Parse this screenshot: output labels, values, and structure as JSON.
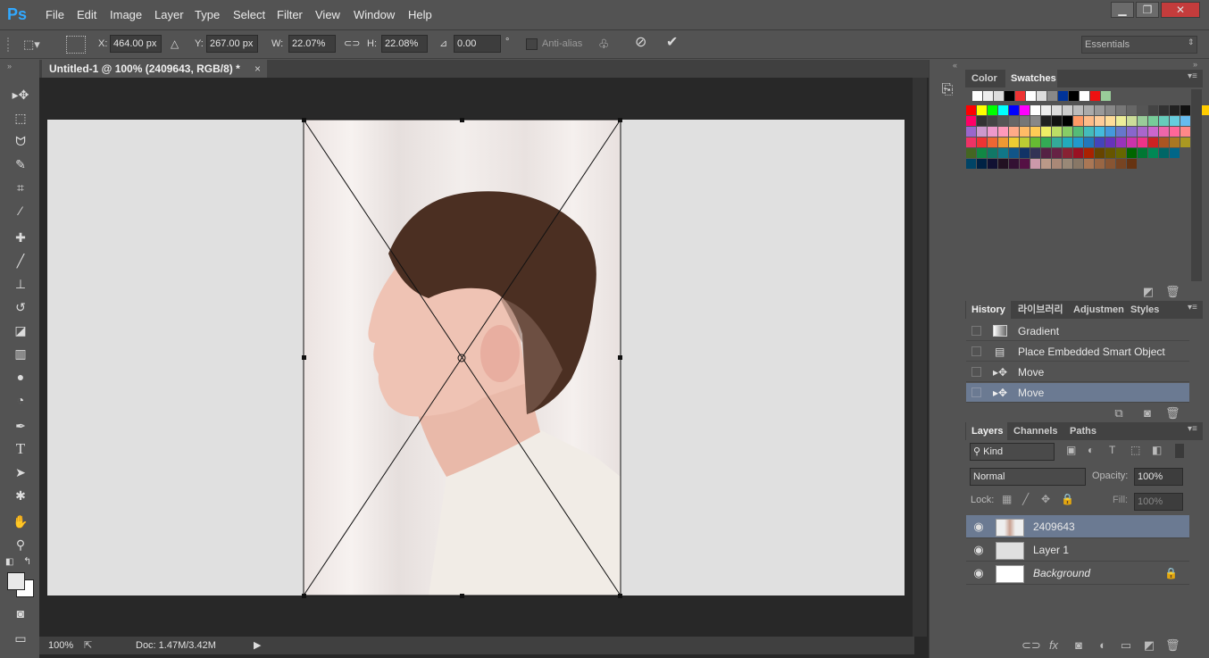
{
  "app": {
    "logo": "Ps"
  },
  "menu": [
    "File",
    "Edit",
    "Image",
    "Layer",
    "Type",
    "Select",
    "Filter",
    "View",
    "Window",
    "Help"
  ],
  "window_controls": {
    "minimize": "▁",
    "restore": "❐",
    "close": "✕"
  },
  "options": {
    "x_label": "X:",
    "x_value": "464.00 px",
    "y_label": "Y:",
    "y_value": "267.00 px",
    "w_label": "W:",
    "w_value": "22.07%",
    "h_label": "H:",
    "h_value": "22.08%",
    "angle_value": "0.00",
    "angle_unit": "°",
    "antialias": "Anti-alias",
    "workspace": "Essentials"
  },
  "document": {
    "tab_title": "Untitled-1 @ 100% (2409643, RGB/8) *",
    "close": "×"
  },
  "status": {
    "zoom": "100%",
    "doc": "Doc: 1.47M/3.42M"
  },
  "swatches_panel": {
    "tabs": [
      "Color",
      "Swatches"
    ],
    "active": "Swatches"
  },
  "history_panel": {
    "tabs": [
      "History",
      "라이브러리",
      "Adjustmen",
      "Styles"
    ],
    "items": [
      "Gradient",
      "Place Embedded Smart Object",
      "Move",
      "Move"
    ],
    "selected_index": 3
  },
  "layers_panel": {
    "tabs": [
      "Layers",
      "Channels",
      "Paths"
    ],
    "kind": "Kind",
    "blend_mode": "Normal",
    "opacity_label": "Opacity:",
    "opacity_value": "100%",
    "lock_label": "Lock:",
    "fill_label": "Fill:",
    "fill_value": "100%",
    "layers": [
      {
        "name": "2409643",
        "selected": true
      },
      {
        "name": "Layer 1",
        "selected": false
      },
      {
        "name": "Background",
        "selected": false,
        "locked": true
      }
    ]
  },
  "colors": {
    "accent_blue": "#31a8ff",
    "selection": "#6b7a92"
  }
}
